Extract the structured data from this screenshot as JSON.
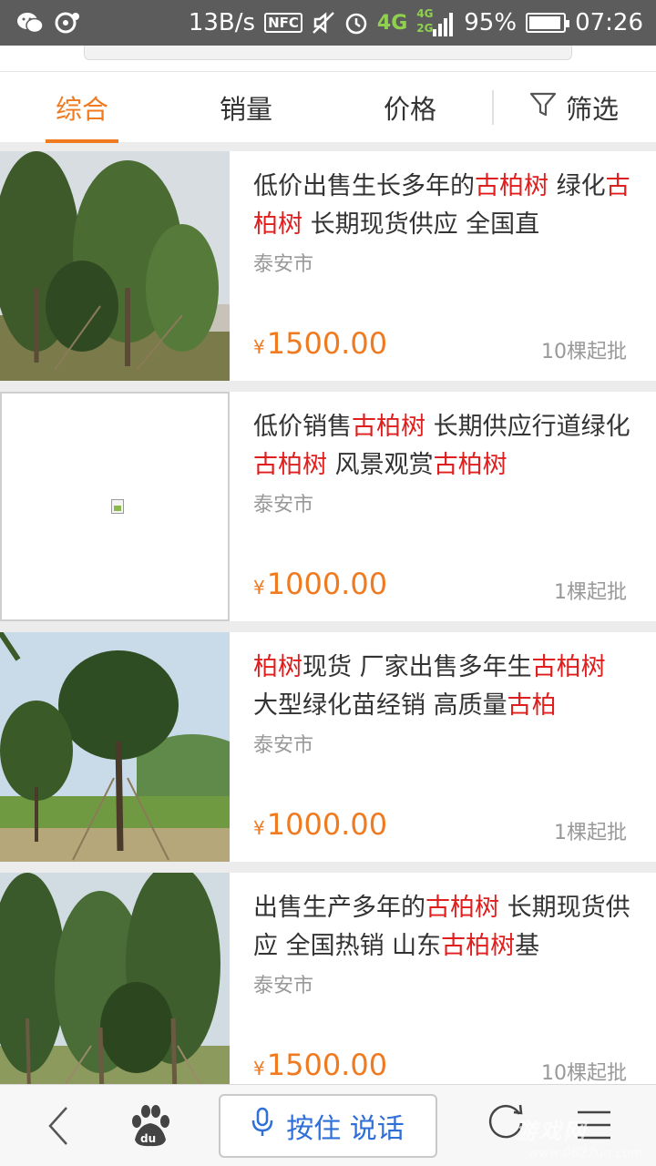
{
  "status_bar": {
    "network_speed": "13B/s",
    "nfc": "NFC",
    "net_4g": "4G",
    "net_4g_small": "4G",
    "net_2g_small": "2G",
    "battery": "95%",
    "battery_level": 0.95,
    "time": "07:26",
    "icons": [
      "wechat-icon",
      "notification-icon",
      "nfc-icon",
      "mute-icon",
      "alarm-icon",
      "signal-icon",
      "battery-icon"
    ]
  },
  "tabs": [
    {
      "label": "综合",
      "active": true
    },
    {
      "label": "销量",
      "active": false
    },
    {
      "label": "价格",
      "active": false
    },
    {
      "label": "筛选",
      "active": false,
      "icon": "filter-icon"
    }
  ],
  "products": [
    {
      "title_parts": [
        "低价出售生长多年的",
        "古柏树",
        " 绿化",
        "古柏树",
        " 长期现货供应 全国直"
      ],
      "city": "泰安市",
      "currency": "¥",
      "price": "1500.00",
      "moq": "10棵起批",
      "image": "photo-cypress-trees"
    },
    {
      "title_parts": [
        "低价销售",
        "古柏树",
        " 长期供应行道绿化",
        "古柏树",
        " 风景观赏",
        "古柏树"
      ],
      "city": "泰安市",
      "currency": "¥",
      "price": "1000.00",
      "moq": "1棵起批",
      "image": "broken-image"
    },
    {
      "title_parts": [
        "柏树",
        "现货 厂家出售多年生",
        "古柏树",
        " 大型绿化苗经销 高质量",
        "古柏"
      ],
      "city": "泰安市",
      "currency": "¥",
      "price": "1000.00",
      "moq": "1棵起批",
      "image": "photo-cypress-single"
    },
    {
      "title_parts": [
        "出售生产多年的",
        "古柏树",
        " 长期现货供应 全国热销 山东",
        "古柏树",
        "基"
      ],
      "city": "泰安市",
      "currency": "¥",
      "price": "1500.00",
      "moq": "10棵起批",
      "image": "photo-cypress-grove"
    }
  ],
  "bottom_bar": {
    "voice_label": "按住 说话",
    "icons": [
      "back-icon",
      "baidu-paw-icon",
      "microphone-icon",
      "refresh-icon",
      "menu-icon"
    ]
  },
  "watermark": "游戏网",
  "watermark_sub": "www.0827uq.com",
  "colors": {
    "accent": "#f07a1f",
    "highlight": "#e01e1e",
    "voice_blue": "#2e6fd8",
    "status_bar": "#5c5c5c"
  }
}
